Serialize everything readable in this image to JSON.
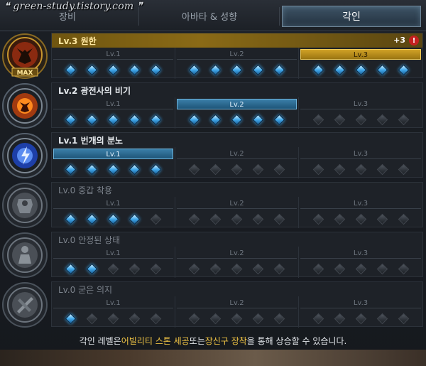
{
  "watermark": "green-study.tistory.com",
  "tabs": [
    {
      "label": "장비"
    },
    {
      "label": "아바타 & 성향"
    },
    {
      "label": "각인"
    }
  ],
  "level_labels": [
    "Lv.1",
    "Lv.2",
    "Lv.3"
  ],
  "rows": [
    {
      "title": "Lv.3 원한",
      "emblem": "demon-head-icon",
      "badge": "MAX",
      "bonus": "+3",
      "alert": "!",
      "active_level": 3,
      "filled": [
        5,
        5,
        5
      ]
    },
    {
      "title": "Lv.2 광전사의 비기",
      "emblem": "berserker-flame-icon",
      "active_level": 2,
      "filled": [
        5,
        5,
        0
      ]
    },
    {
      "title": "Lv.1 번개의 분노",
      "emblem": "lightning-orb-icon",
      "active_level": 1,
      "filled": [
        5,
        0,
        0
      ]
    },
    {
      "title": "Lv.0 중갑 착용",
      "emblem": "heavy-armor-icon",
      "active_level": 0,
      "filled": [
        4,
        0,
        0
      ]
    },
    {
      "title": "Lv.0 안정된 상태",
      "emblem": "stable-state-icon",
      "active_level": 0,
      "filled": [
        2,
        0,
        0
      ]
    },
    {
      "title": "Lv.0 굳은 의지",
      "emblem": "firm-will-icon",
      "active_level": 0,
      "filled": [
        1,
        0,
        0
      ]
    }
  ],
  "footer": {
    "prefix": "각인 레벨은 ",
    "highlight1": "어빌리티 스톤 세공",
    "middle": " 또는 ",
    "highlight2": "장신구 장착",
    "suffix": "을 통해 상승할 수 있습니다."
  },
  "colors": {
    "gold": "#d0a126",
    "blue": "#3a7ea8",
    "gem_on": "#41a8ea",
    "highlight": "#f2c645"
  }
}
